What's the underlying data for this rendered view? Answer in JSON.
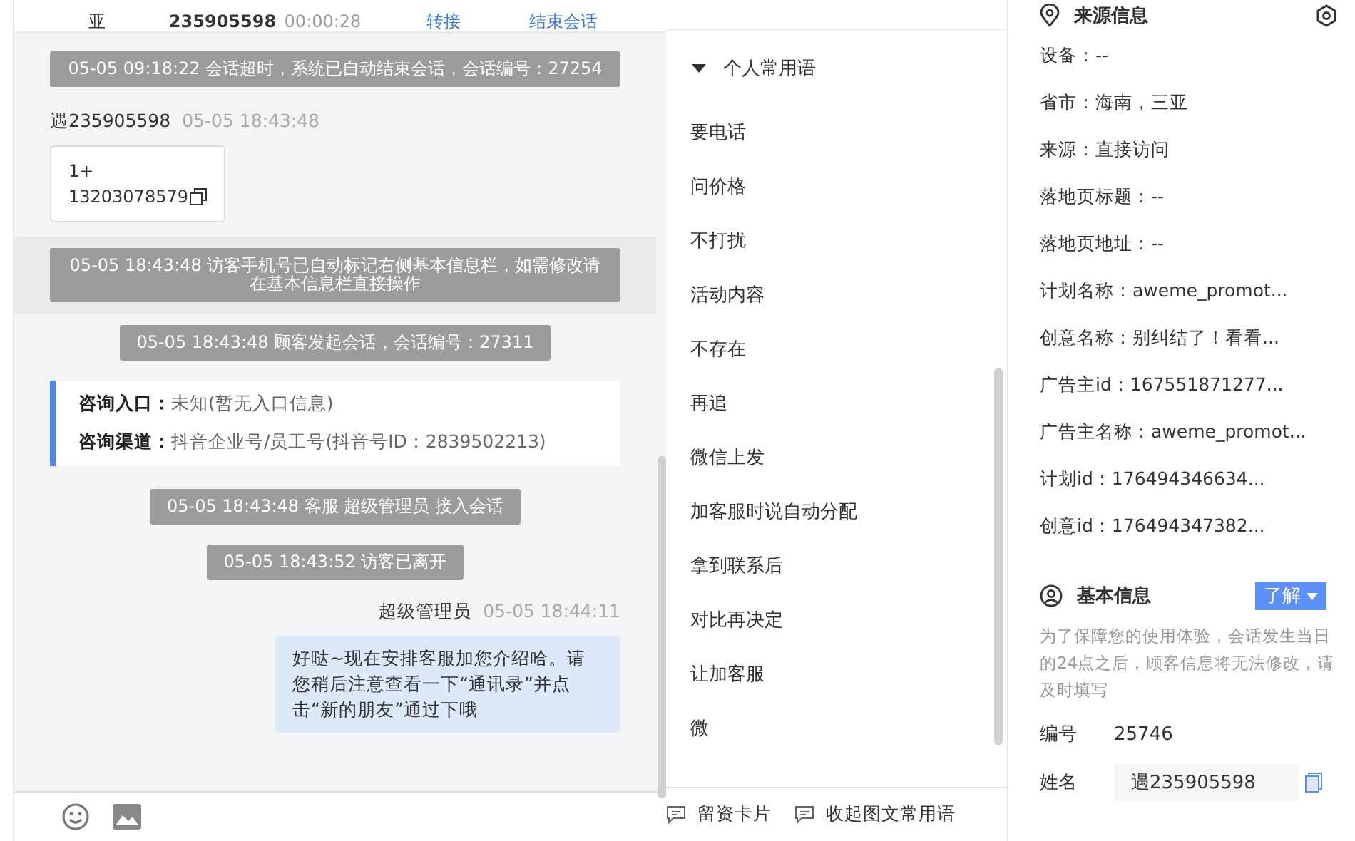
{
  "header": {
    "name": "亚",
    "visitor_id": "235905598",
    "timer": "00:00:28",
    "actions": [
      "转接",
      "结束会话"
    ]
  },
  "chat": [
    {
      "kind": "system",
      "text": "05-05 09:18:22 会话超时，系统已自动结束会话，会话编号：27254",
      "highlighted": false
    },
    {
      "kind": "visitor",
      "sender": "遇235905598",
      "time": "05-05 18:43:48",
      "lines": [
        "1+",
        "13203078579"
      ]
    },
    {
      "kind": "system",
      "text": "05-05 18:43:48 访客手机号已自动标记右侧基本信息栏，如需修改请在基本信息栏直接操作",
      "highlighted": true
    },
    {
      "kind": "system",
      "text": "05-05 18:43:48 顾客发起会话，会话编号：27311",
      "highlighted": false
    },
    {
      "kind": "info",
      "rows": [
        {
          "label": "咨询入口：",
          "value": "未知(暂无入口信息)"
        },
        {
          "label": "咨询渠道：",
          "value": "抖音企业号/员工号(抖音号ID：2839502213)"
        }
      ]
    },
    {
      "kind": "system",
      "text": "05-05 18:43:48 客服 超级管理员 接入会话",
      "highlighted": false
    },
    {
      "kind": "system",
      "text": "05-05 18:43:52 访客已离开",
      "highlighted": false
    },
    {
      "kind": "agent",
      "sender": "超级管理员",
      "time": "05-05 18:44:11",
      "text": "好哒~现在安排客服加您介绍哈。请您稍后注意查看一下“通讯录”并点击“新的朋友”通过下哦"
    }
  ],
  "phrases": {
    "group": {
      "label": "个人常用语",
      "expanded": true
    },
    "items": [
      "要电话",
      "问价格",
      "不打扰",
      "活动内容",
      "不存在",
      "再追",
      "微信上发",
      "加客服时说自动分配",
      "拿到联系后",
      "对比再决定",
      "让加客服",
      "微"
    ]
  },
  "footer_buttons": [
    "留资卡片",
    "收起图文常用语"
  ],
  "source_info": {
    "title": "来源信息",
    "rows": [
      "设备：--",
      "省市：海南，三亚",
      "来源：直接访问",
      "落地页标题：--",
      "落地页地址：--",
      "计划名称：aweme_promot...",
      "创意名称：别纠结了！看看...",
      "广告主id：167551871277...",
      "广告主名称：aweme_promot...",
      "计划id：176494346634...",
      "创意id：176494347382..."
    ]
  },
  "basic_info": {
    "title": "基本信息",
    "dropdown": "了解",
    "notice": "为了保障您的使用体验，会话发生当日的24点之后，顾客信息将无法修改，请及时填写",
    "id_label": "编号",
    "id_value": "25746",
    "name_label": "姓名",
    "name_value": "遇235905598"
  }
}
